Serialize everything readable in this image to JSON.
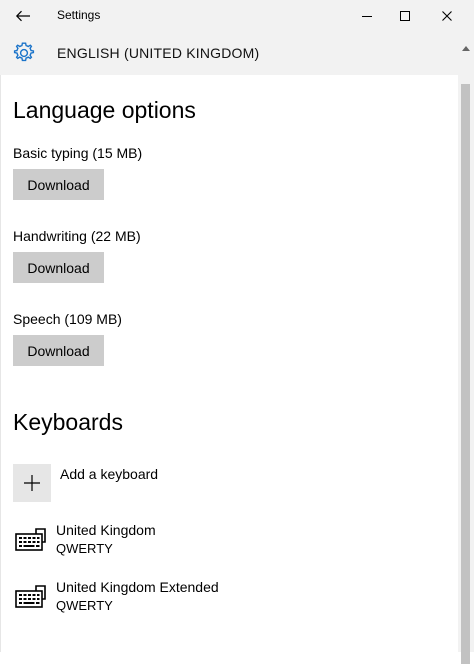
{
  "window": {
    "title": "Settings",
    "controls": {
      "minimize": "minimize-icon",
      "maximize": "maximize-icon",
      "close": "close-icon"
    }
  },
  "header": {
    "title": "ENGLISH (UNITED KINGDOM)",
    "icon": "gear-icon",
    "accent": "#1a73c9"
  },
  "language_options": {
    "heading": "Language options",
    "features": [
      {
        "label": "Basic typing (15 MB)",
        "button": "Download"
      },
      {
        "label": "Handwriting (22 MB)",
        "button": "Download"
      },
      {
        "label": "Speech (109 MB)",
        "button": "Download"
      }
    ]
  },
  "keyboards": {
    "heading": "Keyboards",
    "add_label": "Add a keyboard",
    "items": [
      {
        "name": "United Kingdom",
        "layout": "QWERTY",
        "icon": "keyboard-icon"
      },
      {
        "name": "United Kingdom Extended",
        "layout": "QWERTY",
        "icon": "keyboard-icon"
      }
    ]
  },
  "colors": {
    "chrome": "#f2f2f2",
    "button": "#cccccc",
    "scroll_thumb": "#c2c2c2"
  }
}
